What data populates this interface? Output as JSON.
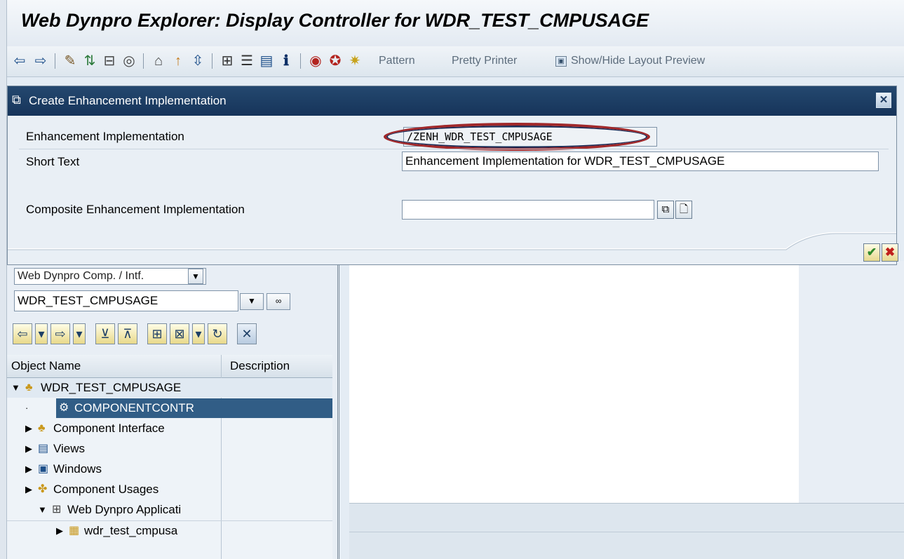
{
  "window": {
    "title": "Web Dynpro Explorer: Display Controller for WDR_TEST_CMPUSAGE"
  },
  "toolbar": {
    "icons": [
      "back-arrow-icon",
      "forward-arrow-icon",
      "display-change-icon",
      "active-inactive-icon",
      "check-icon",
      "activate-icon",
      "where-used-icon",
      "navigate-icon",
      "display-object-list-icon",
      "hierarchy-icon",
      "navigation-window-icon",
      "window-icon",
      "info-icon",
      "test-icon",
      "debug-icon",
      "wizard-icon"
    ],
    "pattern_label": "Pattern",
    "pretty_printer_label": "Pretty Printer",
    "show_hide_label": "Show/Hide Layout Preview"
  },
  "dialog": {
    "title": "Create Enhancement Implementation",
    "enh_impl_label": "Enhancement Implementation",
    "enh_impl_value": "/ZENH_WDR_TEST_CMPUSAGE",
    "short_text_label": "Short Text",
    "short_text_value": "Enhancement Implementation for WDR_TEST_CMPUSAGE",
    "composite_label": "Composite Enhancement Implementation",
    "composite_value": ""
  },
  "left": {
    "object_type": "Web Dynpro Comp. / Intf.",
    "object_name": "WDR_TEST_CMPUSAGE",
    "columns": [
      "Object Name",
      "Description"
    ],
    "tree": [
      {
        "label": "WDR_TEST_CMPUSAGE"
      },
      {
        "label": "COMPONENTCONTR"
      },
      {
        "label": "Component Interface"
      },
      {
        "label": "Views"
      },
      {
        "label": "Windows"
      },
      {
        "label": "Component Usages"
      },
      {
        "label": "Web Dynpro Applicati"
      },
      {
        "label": "wdr_test_cmpusa"
      }
    ]
  },
  "colors": {
    "dialog_title_bg": "#1d3e66",
    "selected_row_bg": "#315d86",
    "highlight_oval": "#a0282a"
  }
}
